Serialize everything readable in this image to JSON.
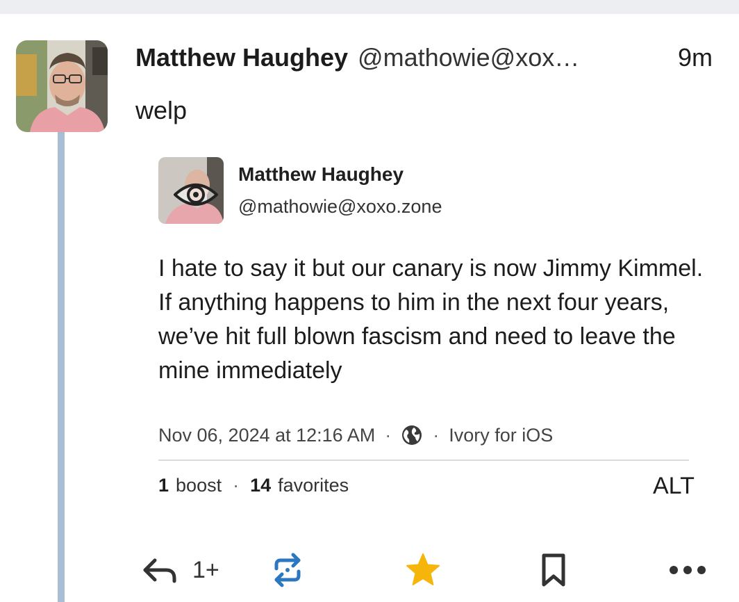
{
  "post": {
    "display_name": "Matthew Haughey",
    "handle": "@mathowie@xox…",
    "time": "9m",
    "text": "welp"
  },
  "embed": {
    "display_name": "Matthew Haughey",
    "handle": "@mathowie@xoxo.zone",
    "body": "I hate to say it but our canary is now Jimmy Kimmel. If anything happens to him in the next four years, we’ve hit full blown fascism and need to leave the mine immediately",
    "timestamp": "Nov 06, 2024 at 12:16 AM",
    "separator": "·",
    "client": "Ivory for iOS",
    "boost_count": "1",
    "boost_label": "boost",
    "favorites_count": "14",
    "favorites_label": "favorites"
  },
  "alt_label": "ALT",
  "actions": {
    "reply_count": "1+",
    "icons": [
      "reply-icon",
      "boost-icon",
      "star-icon",
      "bookmark-icon",
      "more-icon"
    ]
  },
  "colors": {
    "thread_line": "#a9bdd6",
    "boost": "#2b78c0",
    "star": "#f5b50a",
    "topbar": "#eceef2"
  }
}
